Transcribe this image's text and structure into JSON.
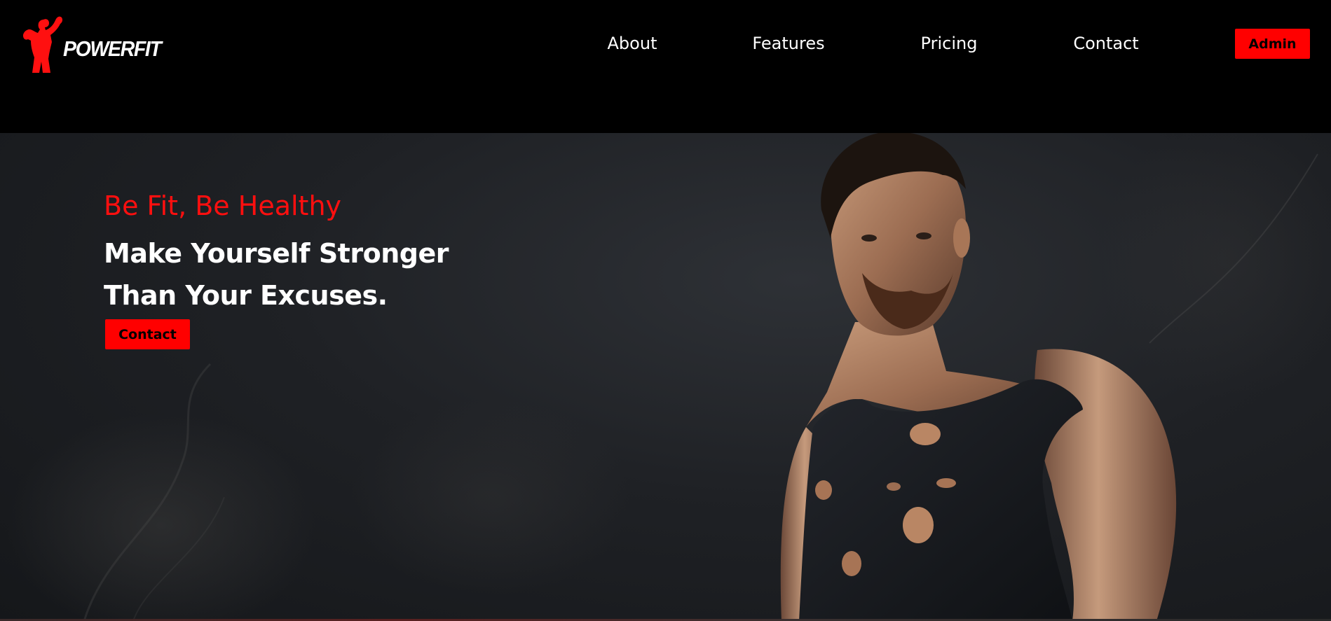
{
  "brand": {
    "name": "POWERFIT",
    "accent_color": "#ff0000",
    "logo_icon": "flexing-bodybuilder-icon"
  },
  "nav": {
    "links": [
      {
        "label": "About"
      },
      {
        "label": "Features"
      },
      {
        "label": "Pricing"
      },
      {
        "label": "Contact"
      }
    ],
    "admin_label": "Admin"
  },
  "hero": {
    "subtitle": "Be Fit, Be Healthy",
    "title_line_1": "Make Yourself Stronger",
    "title_line_2": "Than Your Excuses.",
    "cta_label": "Contact",
    "image": "muscular-man-in-torn-tank-top-photo"
  }
}
